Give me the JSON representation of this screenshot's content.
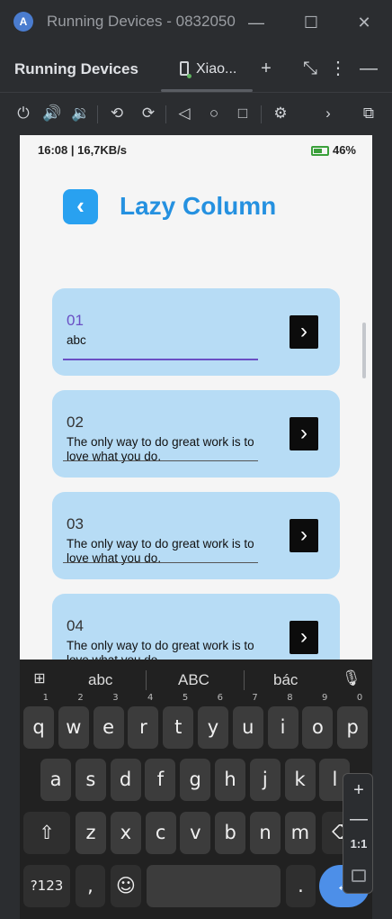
{
  "window": {
    "title": "Running Devices - 0832050",
    "logo_icon": "A",
    "minimize_icon": "—",
    "maximize_icon": "☐",
    "close_icon": "✕"
  },
  "tool_window": {
    "title": "Running Devices",
    "device_tab_label": "Xiao...",
    "add_icon": "+",
    "collapse_icon": "⤡",
    "more_icon": "⋮",
    "hide_icon": "—"
  },
  "toolbar": {
    "power_icon": "⏻",
    "volume_up_icon": "🔊",
    "volume_down_icon": "🔉",
    "rotate_left_icon": "⟲",
    "rotate_right_icon": "⟳",
    "back_icon": "◁",
    "home_icon": "○",
    "overview_icon": "□",
    "device_settings_icon": "⚙",
    "expand_icon": "›",
    "screen_record_icon": "⧉"
  },
  "device": {
    "status_left": "16:08 | 16,7KB/s",
    "status_right": "46%",
    "app_title": "Lazy Column",
    "back_icon": "‹",
    "cards": [
      {
        "number": "01",
        "text": "abc",
        "active": true
      },
      {
        "number": "02",
        "text": "The only way to do great work is to love what you do.",
        "active": false
      },
      {
        "number": "03",
        "text": "The only way to do great work is to love what you do.",
        "active": false
      },
      {
        "number": "04",
        "text": "The only way to do great work is to love what you do.",
        "active": false
      }
    ],
    "card_arrow_icon": "›"
  },
  "keyboard": {
    "grid_icon": "⊞",
    "suggestions": [
      "abc",
      "ABC",
      "bác"
    ],
    "mic_icon": "🎙",
    "row1": [
      {
        "k": "q",
        "n": "1"
      },
      {
        "k": "w",
        "n": "2"
      },
      {
        "k": "e",
        "n": "3"
      },
      {
        "k": "r",
        "n": "4"
      },
      {
        "k": "t",
        "n": "5"
      },
      {
        "k": "y",
        "n": "6"
      },
      {
        "k": "u",
        "n": "7"
      },
      {
        "k": "i",
        "n": "8"
      },
      {
        "k": "o",
        "n": "9"
      },
      {
        "k": "p",
        "n": "0"
      }
    ],
    "row2": [
      "a",
      "s",
      "d",
      "f",
      "g",
      "h",
      "j",
      "k",
      "l"
    ],
    "row3": [
      "z",
      "x",
      "c",
      "v",
      "b",
      "n",
      "m"
    ],
    "shift_icon": "⇧",
    "backspace_icon": "⌫",
    "symbols_label": "?123",
    "comma_label": ",",
    "emoji_icon": "☺",
    "period_label": ".",
    "enter_icon": "←"
  },
  "zoom": {
    "zoom_in_icon": "+",
    "zoom_out_icon": "—",
    "actual_size_label": "1:1"
  }
}
